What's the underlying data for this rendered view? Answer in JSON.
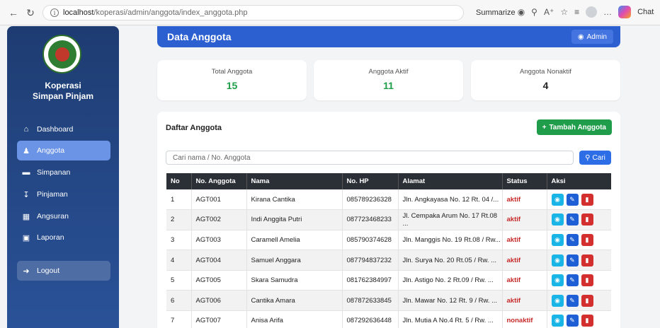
{
  "browser": {
    "url_host": "localhost",
    "url_path": "/koperasi/admin/anggota/index_anggota.php",
    "summarize_label": "Summarize",
    "chat_label": "Chat"
  },
  "sidebar": {
    "brand_line1": "Koperasi",
    "brand_line2": "Simpan Pinjam",
    "items": [
      {
        "label": "Dashboard",
        "icon": "home-icon"
      },
      {
        "label": "Anggota",
        "icon": "users-icon"
      },
      {
        "label": "Simpanan",
        "icon": "wallet-icon"
      },
      {
        "label": "Pinjaman",
        "icon": "hand-holding-icon"
      },
      {
        "label": "Angsuran",
        "icon": "calendar-icon"
      },
      {
        "label": "Laporan",
        "icon": "file-icon"
      }
    ],
    "logout_label": "Logout"
  },
  "header": {
    "title": "Data Anggota",
    "admin_label": "Admin"
  },
  "stats": [
    {
      "label": "Total Anggota",
      "value": "15",
      "color": "#1f9d4a"
    },
    {
      "label": "Anggota Aktif",
      "value": "11",
      "color": "#1f9d4a"
    },
    {
      "label": "Anggota Nonaktif",
      "value": "4",
      "color": "#222222"
    }
  ],
  "panel": {
    "title": "Daftar Anggota",
    "add_label": "Tambah Anggota",
    "search_placeholder": "Cari nama / No. Anggota",
    "search_btn": "Cari"
  },
  "table": {
    "headers": [
      "No",
      "No. Anggota",
      "Nama",
      "No. HP",
      "Alamat",
      "Status",
      "Aksi"
    ],
    "rows": [
      [
        "1",
        "AGT001",
        "Kirana Cantika",
        "085789236328",
        "Jln. Angkayasa No. 12 Rt. 04 /...",
        "aktif"
      ],
      [
        "2",
        "AGT002",
        "Indi Anggita Putri",
        "087723468233",
        "Jl. Cempaka Arum No. 17 Rt.08 ...",
        "aktif"
      ],
      [
        "3",
        "AGT003",
        "Caramell Amelia",
        "085790374628",
        "Jln. Manggis No. 19 Rt.08 / Rw...",
        "aktif"
      ],
      [
        "4",
        "AGT004",
        "Samuel Anggara",
        "087794837232",
        "Jln. Surya No. 20 Rt.05 / Rw. ...",
        "aktif"
      ],
      [
        "5",
        "AGT005",
        "Skara Samudra",
        "081762384997",
        "Jln. Astigo No. 2 Rt.09 / Rw. ...",
        "aktif"
      ],
      [
        "6",
        "AGT006",
        "Cantika Amara",
        "087872633845",
        "Jln. Mawar No. 12 Rt. 9 / Rw. ...",
        "aktif"
      ],
      [
        "7",
        "AGT007",
        "Anisa Arifa",
        "087292636448",
        "Jln. Mutia A No.4 Rt. 5 / Rw. ...",
        "nonaktif"
      ]
    ]
  }
}
